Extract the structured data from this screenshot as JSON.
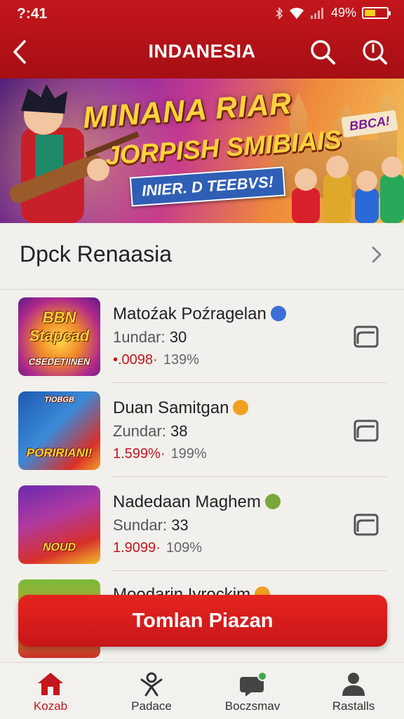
{
  "status_bar": {
    "time": "?:41",
    "battery_text": "49%",
    "battery_level": 0.49
  },
  "header": {
    "title": "INDANESIA",
    "back_icon": "back-arrow-icon",
    "search_icon": "search-icon",
    "second_icon": "search-alt-icon"
  },
  "banner": {
    "title_line1": "MINANA RIAR",
    "title_line2": "JORPISH SMIBIAIS",
    "ribbon": "INIER. D TEEBVS!",
    "tag": "BBCA!"
  },
  "section": {
    "title": "Dpck Renaasia",
    "more_icon": "chevron-right-icon"
  },
  "items": [
    {
      "name": "Matoźak Poźragelan",
      "sub_label": "1undar:",
      "sub_value": "30",
      "stat_a": "•.0098·",
      "stat_b": "139%",
      "thumb_title": "BBN Stapcad",
      "thumb_sub": "CSEDETIINEN",
      "emoji_color": "#3b6fd8"
    },
    {
      "name": "Duan Samitgan",
      "sub_label": "Zundar:",
      "sub_value": "38",
      "stat_a": "1.599%·",
      "stat_b": "199%",
      "thumb_title": "PORIRIANI!",
      "thumb_sub": "TIOBGB",
      "emoji_color": "#f0a020"
    },
    {
      "name": "Nadedaan Maghem",
      "sub_label": "Sundar:",
      "sub_value": "33",
      "stat_a": "1.9099·",
      "stat_b": "109%",
      "thumb_title": "NOUD",
      "thumb_sub": "",
      "emoji_color": "#7aa83a"
    },
    {
      "name": "Moodarin Iyrockim",
      "sub_label": "",
      "sub_value": "",
      "stat_a": "",
      "stat_b": "",
      "thumb_title": "",
      "thumb_sub": "",
      "emoji_color": "#f0a020"
    }
  ],
  "cta": {
    "label": "Tomlan Piazan"
  },
  "nav": [
    {
      "label": "Kozab",
      "icon": "home-icon",
      "active": true
    },
    {
      "label": "Padace",
      "icon": "people-icon",
      "active": false
    },
    {
      "label": "Boczsmav",
      "icon": "chat-icon",
      "active": false
    },
    {
      "label": "Rastalls",
      "icon": "user-icon",
      "active": false
    }
  ],
  "colors": {
    "brand_red": "#c4161c",
    "accent_yellow": "#f6d21c"
  }
}
